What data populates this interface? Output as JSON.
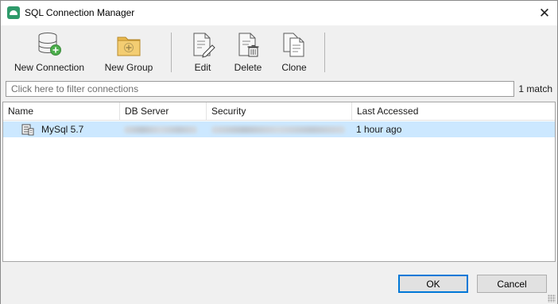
{
  "window": {
    "title": "SQL Connection Manager",
    "close_glyph": "✕"
  },
  "toolbar": {
    "new_connection": "New Connection",
    "new_group": "New Group",
    "edit": "Edit",
    "delete": "Delete",
    "clone": "Clone"
  },
  "filter": {
    "placeholder": "Click here to filter connections",
    "value": "",
    "match_count": "1 match"
  },
  "table": {
    "columns": [
      "Name",
      "DB Server",
      "Security",
      "Last Accessed"
    ],
    "rows": [
      {
        "name": "MySql 5.7",
        "db_server": "",
        "security": "",
        "last_accessed": "1 hour ago",
        "selected": true
      }
    ]
  },
  "buttons": {
    "ok": "OK",
    "cancel": "Cancel"
  },
  "colors": {
    "selection": "#cce8ff",
    "accent": "#0078d7",
    "app_icon": "#2e9a6a",
    "folder": "#e9b94f",
    "add_badge": "#4cae4c"
  },
  "icons": {
    "app": "connection-manager-icon",
    "new_connection": "database-add-icon",
    "new_group": "folder-add-icon",
    "edit": "document-edit-icon",
    "delete": "document-delete-icon",
    "clone": "document-clone-icon",
    "row": "mysql-connection-icon",
    "close": "close-icon"
  }
}
